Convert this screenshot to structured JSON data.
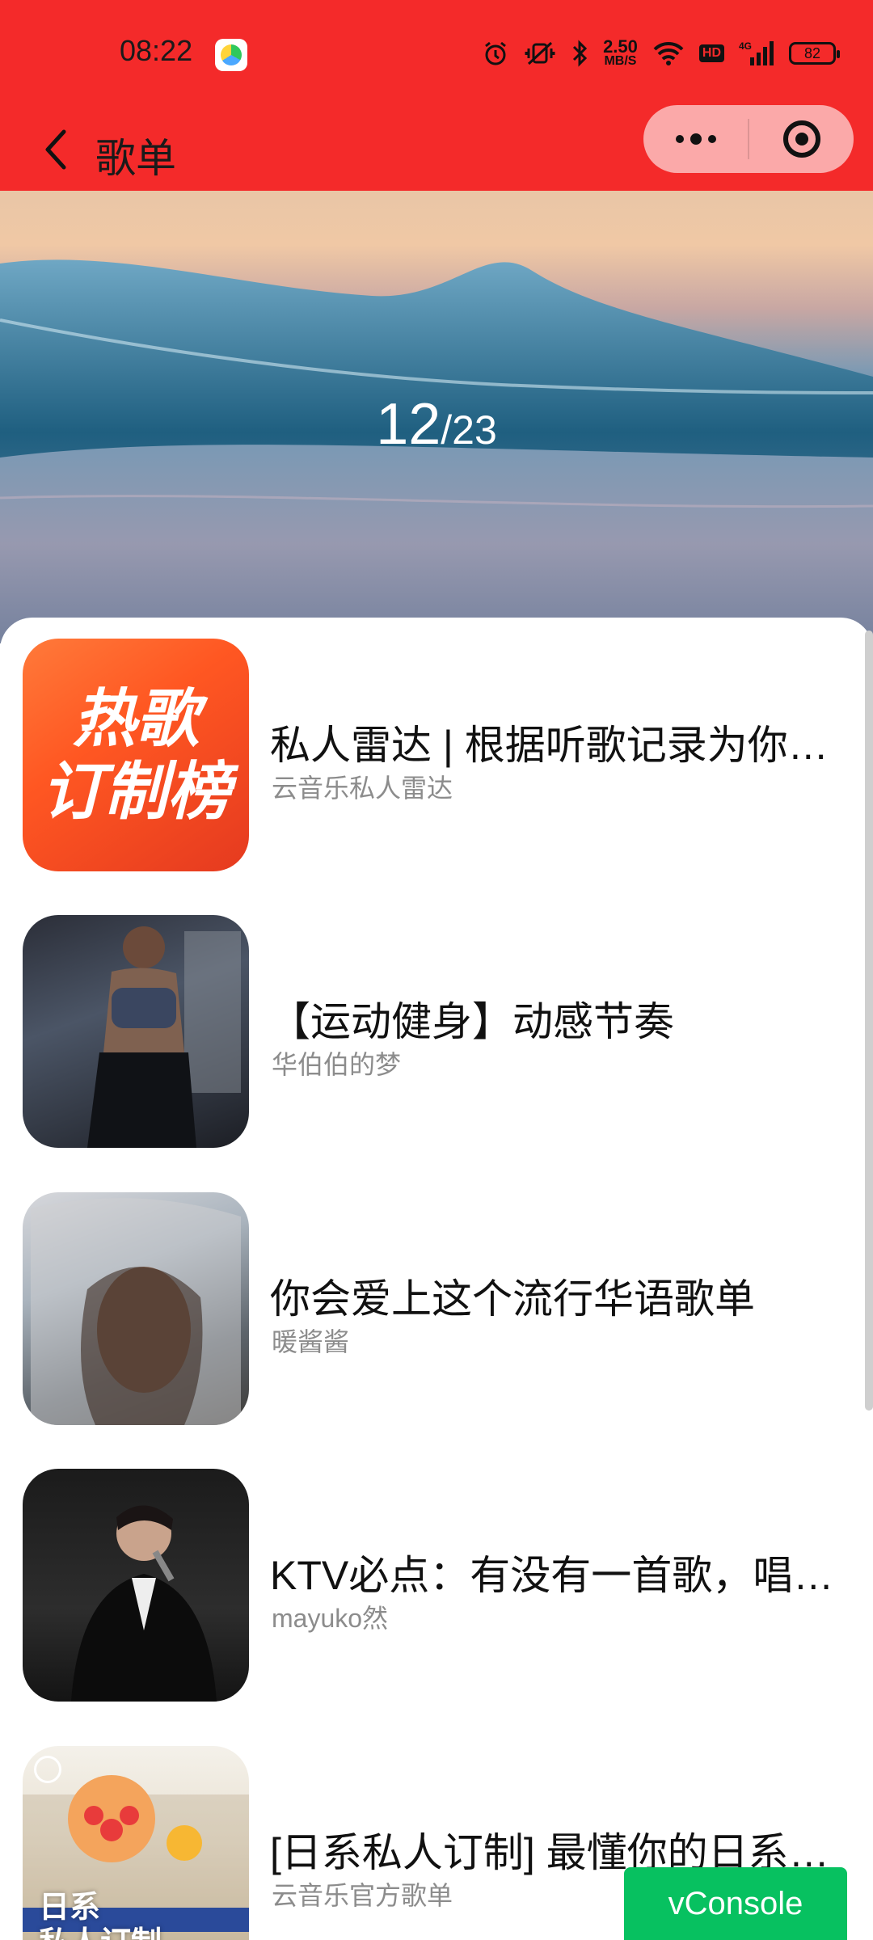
{
  "status_bar": {
    "time": "08:22",
    "app_icon": "video-app-icon",
    "speed_value": "2.50",
    "speed_unit": "MB/S",
    "network": "4G",
    "hd": "HD",
    "battery": "82",
    "icons": [
      "alarm-icon",
      "vibrate-off-icon",
      "bluetooth-icon",
      "wifi-icon",
      "signal-icon"
    ]
  },
  "header": {
    "title": "歌单",
    "back_icon": "chevron-left-icon",
    "menu_icon": "more-dots-icon",
    "close_icon": "target-icon",
    "bg_color": "#f42a2a"
  },
  "banner": {
    "current": "12",
    "total": "/23"
  },
  "playlists": [
    {
      "title": "私人雷达 | 根据听歌记录为你打造",
      "subtitle": "云音乐私人雷达",
      "cover_line1": "热歌",
      "cover_line2": "订制榜"
    },
    {
      "title": "【运动健身】动感节奏",
      "subtitle": "华伯伯的梦"
    },
    {
      "title": "你会爱上这个流行华语歌单",
      "subtitle": "暖酱酱"
    },
    {
      "title": "KTV必点：有没有一首歌，唱出你心声",
      "subtitle": "mayuko然"
    },
    {
      "title": "[日系私人订制] 最懂你的日系推荐",
      "subtitle": "云音乐官方歌单",
      "cover_label": "日系\n私人订制"
    }
  ],
  "vconsole": {
    "label": "vConsole",
    "color": "#07c160"
  }
}
